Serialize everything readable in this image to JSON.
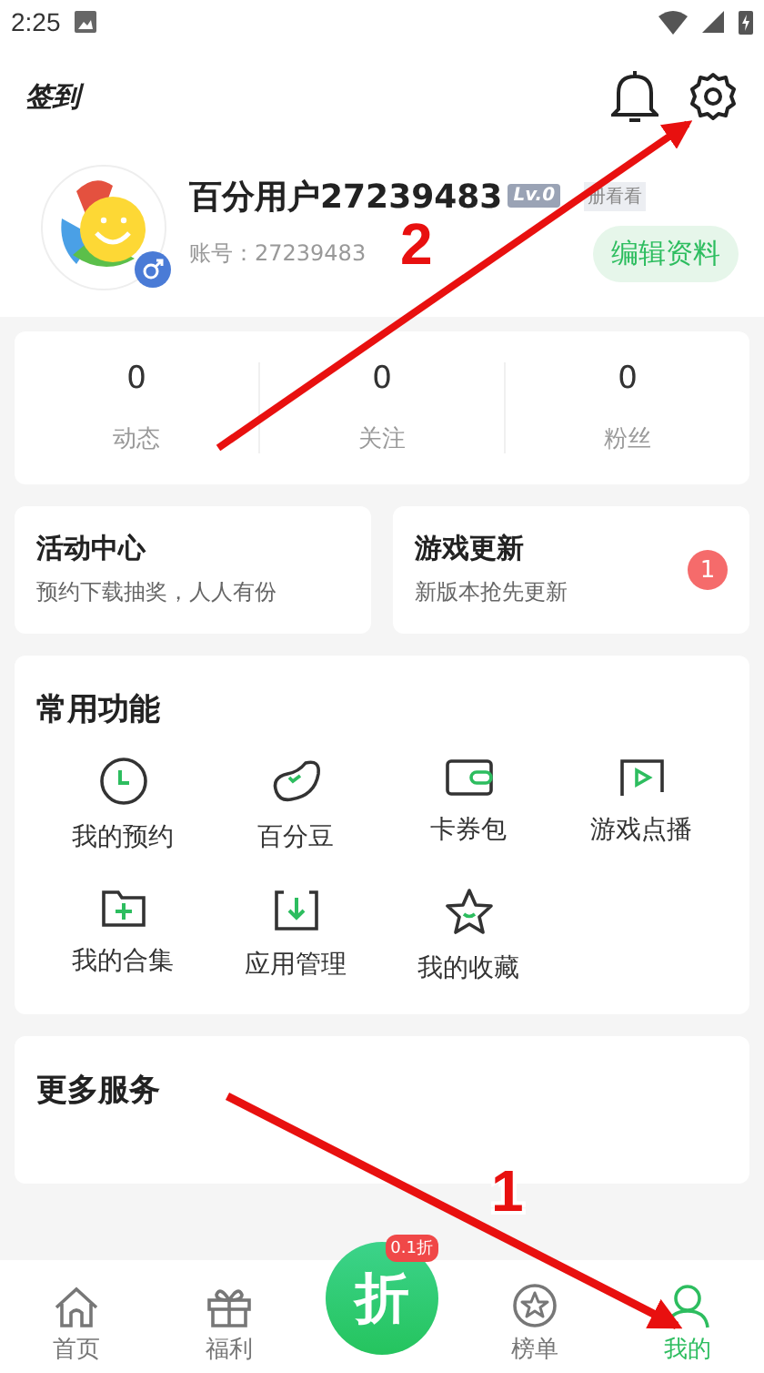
{
  "status_bar": {
    "time": "2:25"
  },
  "header": {
    "checkin": "签到"
  },
  "profile": {
    "name": "百分用户27239483",
    "level_badge": "Lv.0",
    "badge_note": "册看看",
    "account": "账号：27239483",
    "edit_button": "编辑资料"
  },
  "stats": [
    {
      "value": "0",
      "label": "动态"
    },
    {
      "value": "0",
      "label": "关注"
    },
    {
      "value": "0",
      "label": "粉丝"
    }
  ],
  "promo_cards": [
    {
      "title": "活动中心",
      "subtitle": "预约下载抽奖，人人有份"
    },
    {
      "title": "游戏更新",
      "subtitle": "新版本抢先更新",
      "badge": "1"
    }
  ],
  "common_functions": {
    "title": "常用功能",
    "items": [
      {
        "kind": "clock",
        "label": "我的预约"
      },
      {
        "kind": "bean",
        "label": "百分豆"
      },
      {
        "kind": "wallet",
        "label": "卡券包"
      },
      {
        "kind": "play",
        "label": "游戏点播"
      },
      {
        "kind": "folder",
        "label": "我的合集"
      },
      {
        "kind": "download",
        "label": "应用管理"
      },
      {
        "kind": "star",
        "label": "我的收藏"
      }
    ]
  },
  "more_services": {
    "title": "更多服务"
  },
  "bottom_nav": [
    {
      "kind": "home",
      "label": "首页",
      "selected": false
    },
    {
      "kind": "gift",
      "label": "福利",
      "selected": false
    },
    {
      "kind": "discount",
      "label": "折",
      "badge": "0.1折",
      "selected": false
    },
    {
      "kind": "rank",
      "label": "榜单",
      "selected": false
    },
    {
      "kind": "user",
      "label": "我的",
      "selected": true
    }
  ],
  "annotations": [
    {
      "number": "2"
    },
    {
      "number": "1"
    }
  ]
}
